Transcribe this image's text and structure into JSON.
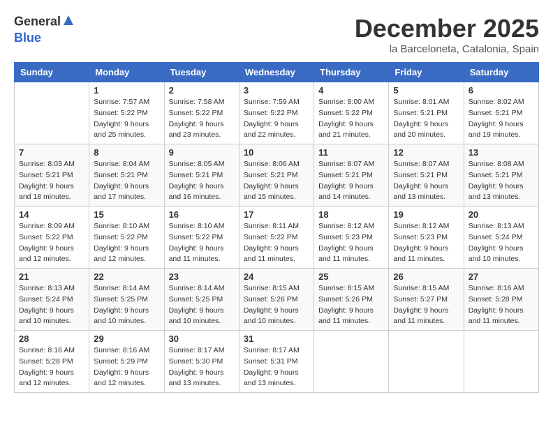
{
  "logo": {
    "general": "General",
    "blue": "Blue"
  },
  "title": "December 2025",
  "location": "la Barceloneta, Catalonia, Spain",
  "days_of_week": [
    "Sunday",
    "Monday",
    "Tuesday",
    "Wednesday",
    "Thursday",
    "Friday",
    "Saturday"
  ],
  "weeks": [
    [
      {
        "day": "",
        "sunrise": "",
        "sunset": "",
        "daylight": ""
      },
      {
        "day": "1",
        "sunrise": "Sunrise: 7:57 AM",
        "sunset": "Sunset: 5:22 PM",
        "daylight": "Daylight: 9 hours and 25 minutes."
      },
      {
        "day": "2",
        "sunrise": "Sunrise: 7:58 AM",
        "sunset": "Sunset: 5:22 PM",
        "daylight": "Daylight: 9 hours and 23 minutes."
      },
      {
        "day": "3",
        "sunrise": "Sunrise: 7:59 AM",
        "sunset": "Sunset: 5:22 PM",
        "daylight": "Daylight: 9 hours and 22 minutes."
      },
      {
        "day": "4",
        "sunrise": "Sunrise: 8:00 AM",
        "sunset": "Sunset: 5:22 PM",
        "daylight": "Daylight: 9 hours and 21 minutes."
      },
      {
        "day": "5",
        "sunrise": "Sunrise: 8:01 AM",
        "sunset": "Sunset: 5:21 PM",
        "daylight": "Daylight: 9 hours and 20 minutes."
      },
      {
        "day": "6",
        "sunrise": "Sunrise: 8:02 AM",
        "sunset": "Sunset: 5:21 PM",
        "daylight": "Daylight: 9 hours and 19 minutes."
      }
    ],
    [
      {
        "day": "7",
        "sunrise": "Sunrise: 8:03 AM",
        "sunset": "Sunset: 5:21 PM",
        "daylight": "Daylight: 9 hours and 18 minutes."
      },
      {
        "day": "8",
        "sunrise": "Sunrise: 8:04 AM",
        "sunset": "Sunset: 5:21 PM",
        "daylight": "Daylight: 9 hours and 17 minutes."
      },
      {
        "day": "9",
        "sunrise": "Sunrise: 8:05 AM",
        "sunset": "Sunset: 5:21 PM",
        "daylight": "Daylight: 9 hours and 16 minutes."
      },
      {
        "day": "10",
        "sunrise": "Sunrise: 8:06 AM",
        "sunset": "Sunset: 5:21 PM",
        "daylight": "Daylight: 9 hours and 15 minutes."
      },
      {
        "day": "11",
        "sunrise": "Sunrise: 8:07 AM",
        "sunset": "Sunset: 5:21 PM",
        "daylight": "Daylight: 9 hours and 14 minutes."
      },
      {
        "day": "12",
        "sunrise": "Sunrise: 8:07 AM",
        "sunset": "Sunset: 5:21 PM",
        "daylight": "Daylight: 9 hours and 13 minutes."
      },
      {
        "day": "13",
        "sunrise": "Sunrise: 8:08 AM",
        "sunset": "Sunset: 5:21 PM",
        "daylight": "Daylight: 9 hours and 13 minutes."
      }
    ],
    [
      {
        "day": "14",
        "sunrise": "Sunrise: 8:09 AM",
        "sunset": "Sunset: 5:22 PM",
        "daylight": "Daylight: 9 hours and 12 minutes."
      },
      {
        "day": "15",
        "sunrise": "Sunrise: 8:10 AM",
        "sunset": "Sunset: 5:22 PM",
        "daylight": "Daylight: 9 hours and 12 minutes."
      },
      {
        "day": "16",
        "sunrise": "Sunrise: 8:10 AM",
        "sunset": "Sunset: 5:22 PM",
        "daylight": "Daylight: 9 hours and 11 minutes."
      },
      {
        "day": "17",
        "sunrise": "Sunrise: 8:11 AM",
        "sunset": "Sunset: 5:22 PM",
        "daylight": "Daylight: 9 hours and 11 minutes."
      },
      {
        "day": "18",
        "sunrise": "Sunrise: 8:12 AM",
        "sunset": "Sunset: 5:23 PM",
        "daylight": "Daylight: 9 hours and 11 minutes."
      },
      {
        "day": "19",
        "sunrise": "Sunrise: 8:12 AM",
        "sunset": "Sunset: 5:23 PM",
        "daylight": "Daylight: 9 hours and 11 minutes."
      },
      {
        "day": "20",
        "sunrise": "Sunrise: 8:13 AM",
        "sunset": "Sunset: 5:24 PM",
        "daylight": "Daylight: 9 hours and 10 minutes."
      }
    ],
    [
      {
        "day": "21",
        "sunrise": "Sunrise: 8:13 AM",
        "sunset": "Sunset: 5:24 PM",
        "daylight": "Daylight: 9 hours and 10 minutes."
      },
      {
        "day": "22",
        "sunrise": "Sunrise: 8:14 AM",
        "sunset": "Sunset: 5:25 PM",
        "daylight": "Daylight: 9 hours and 10 minutes."
      },
      {
        "day": "23",
        "sunrise": "Sunrise: 8:14 AM",
        "sunset": "Sunset: 5:25 PM",
        "daylight": "Daylight: 9 hours and 10 minutes."
      },
      {
        "day": "24",
        "sunrise": "Sunrise: 8:15 AM",
        "sunset": "Sunset: 5:26 PM",
        "daylight": "Daylight: 9 hours and 10 minutes."
      },
      {
        "day": "25",
        "sunrise": "Sunrise: 8:15 AM",
        "sunset": "Sunset: 5:26 PM",
        "daylight": "Daylight: 9 hours and 11 minutes."
      },
      {
        "day": "26",
        "sunrise": "Sunrise: 8:15 AM",
        "sunset": "Sunset: 5:27 PM",
        "daylight": "Daylight: 9 hours and 11 minutes."
      },
      {
        "day": "27",
        "sunrise": "Sunrise: 8:16 AM",
        "sunset": "Sunset: 5:28 PM",
        "daylight": "Daylight: 9 hours and 11 minutes."
      }
    ],
    [
      {
        "day": "28",
        "sunrise": "Sunrise: 8:16 AM",
        "sunset": "Sunset: 5:28 PM",
        "daylight": "Daylight: 9 hours and 12 minutes."
      },
      {
        "day": "29",
        "sunrise": "Sunrise: 8:16 AM",
        "sunset": "Sunset: 5:29 PM",
        "daylight": "Daylight: 9 hours and 12 minutes."
      },
      {
        "day": "30",
        "sunrise": "Sunrise: 8:17 AM",
        "sunset": "Sunset: 5:30 PM",
        "daylight": "Daylight: 9 hours and 13 minutes."
      },
      {
        "day": "31",
        "sunrise": "Sunrise: 8:17 AM",
        "sunset": "Sunset: 5:31 PM",
        "daylight": "Daylight: 9 hours and 13 minutes."
      },
      {
        "day": "",
        "sunrise": "",
        "sunset": "",
        "daylight": ""
      },
      {
        "day": "",
        "sunrise": "",
        "sunset": "",
        "daylight": ""
      },
      {
        "day": "",
        "sunrise": "",
        "sunset": "",
        "daylight": ""
      }
    ]
  ]
}
